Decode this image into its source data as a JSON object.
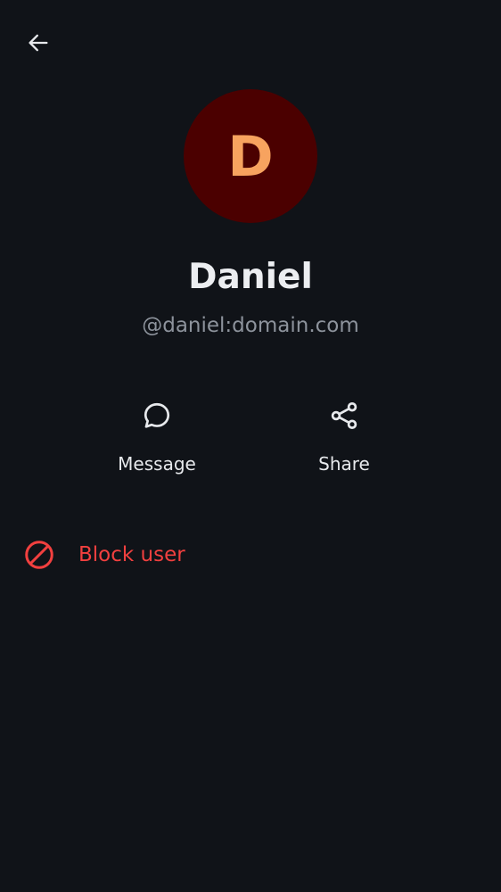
{
  "header": {
    "back_icon": "arrow-left-icon"
  },
  "profile": {
    "avatar_initial": "D",
    "avatar_bg": "#4b0000",
    "avatar_fg": "#f7a35f",
    "display_name": "Daniel",
    "user_id": "@daniel:domain.com"
  },
  "actions": [
    {
      "label": "Message",
      "icon": "chat-bubble-icon"
    },
    {
      "label": "Share",
      "icon": "share-icon"
    }
  ],
  "danger": {
    "block_label": "Block user",
    "block_icon": "block-icon",
    "color": "#f2403f"
  }
}
